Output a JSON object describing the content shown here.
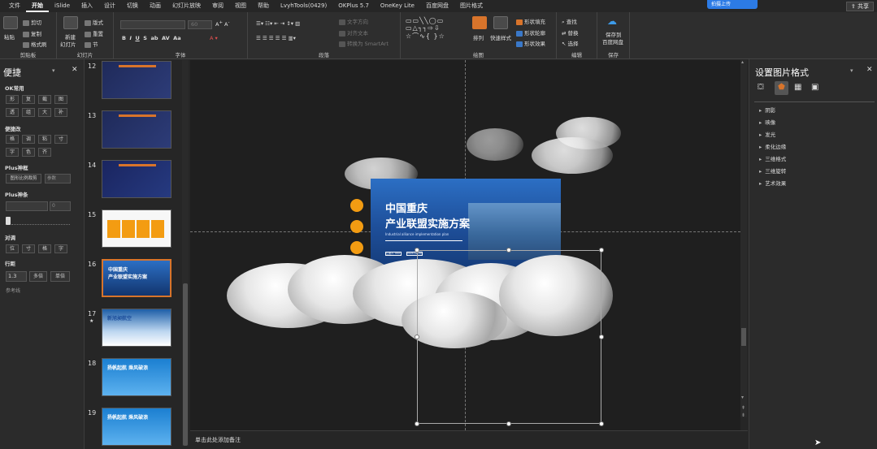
{
  "menu": [
    "文件",
    "开始",
    "iSlide",
    "插入",
    "设计",
    "切换",
    "动画",
    "幻灯片放映",
    "审阅",
    "视图",
    "帮助",
    "LvyhTools(0429)",
    "OKPlus 5.7",
    "OneKey Lite",
    "百度网盘",
    "图片格式"
  ],
  "share_label": "共享",
  "float_label": "拍摄上传",
  "ribbon": {
    "clipboard": {
      "paste": "粘贴",
      "cut": "剪切",
      "copy": "复制",
      "format_painter": "格式刷",
      "label": "剪贴板"
    },
    "slides": {
      "new_slide": "新建",
      "new_slide2": "幻灯片",
      "layout": "版式",
      "reset": "重置",
      "section": "节",
      "label": "幻灯片"
    },
    "font": {
      "size": "60",
      "label": "字体"
    },
    "paragraph": {
      "text_dir": "文字方向",
      "align": "对齐文本",
      "smartart": "转换为 SmartArt",
      "label": "段落"
    },
    "drawing": {
      "arrange": "排列",
      "quick_styles": "快速样式",
      "fill": "形状填充",
      "outline": "形状轮廓",
      "effects": "形状效果",
      "label": "绘图"
    },
    "editing": {
      "find": "查找",
      "replace": "替换",
      "select": "选择",
      "label": "编辑"
    },
    "save": {
      "save_to": "保存到",
      "baidu": "百度网盘",
      "label": "保存"
    }
  },
  "left_pane": {
    "title": "便捷",
    "sections": [
      "OK常用",
      "便捷改",
      "Plus神框",
      "Plus神条",
      "对调",
      "行距"
    ],
    "ok_row1": [
      "形",
      "复",
      "截",
      "图"
    ],
    "ok_row2": [
      "透",
      "组",
      "大",
      "补"
    ],
    "edit_row1": [
      "格",
      "调",
      "粘",
      "寸"
    ],
    "edit_row2": [
      "字",
      "色",
      "齐"
    ],
    "plus_btn": "图形比例裁剪",
    "plus_param": "参数",
    "swap_row": [
      "位",
      "寸",
      "格",
      "字"
    ],
    "line_value": "1.3",
    "line_btn1": "多倍",
    "line_btn2": "单倍",
    "ref_label": "参考线"
  },
  "slides": [
    {
      "num": "12",
      "star": ""
    },
    {
      "num": "13",
      "star": ""
    },
    {
      "num": "14",
      "star": ""
    },
    {
      "num": "15",
      "star": ""
    },
    {
      "num": "16",
      "star": ""
    },
    {
      "num": "17",
      "star": "★"
    },
    {
      "num": "18",
      "star": ""
    },
    {
      "num": "19",
      "star": ""
    }
  ],
  "thumb_texts": {
    "t16": "中国重庆\n产业联盟实施方案",
    "t17": "新旭昶航空",
    "t18": "扬帆起航 乘风破浪",
    "t19": "扬帆起航 乘风破浪"
  },
  "slide_main": {
    "title1": "中国重庆",
    "title2": "产业联盟实施方案",
    "subtitle": "Industrial alliance implementation plan",
    "tag1": "汇报人: XXX",
    "tag2": "2020.XX.XX"
  },
  "notes": "单击此处添加备注",
  "right_pane": {
    "title": "设置图片格式",
    "options": [
      "阴影",
      "映像",
      "发光",
      "柔化边缘",
      "三维格式",
      "三维旋转",
      "艺术效果"
    ]
  },
  "colors": {
    "accent": "#d8742b",
    "orange_dot": "#f39c12",
    "slide_blue": "#1a4b9c"
  }
}
